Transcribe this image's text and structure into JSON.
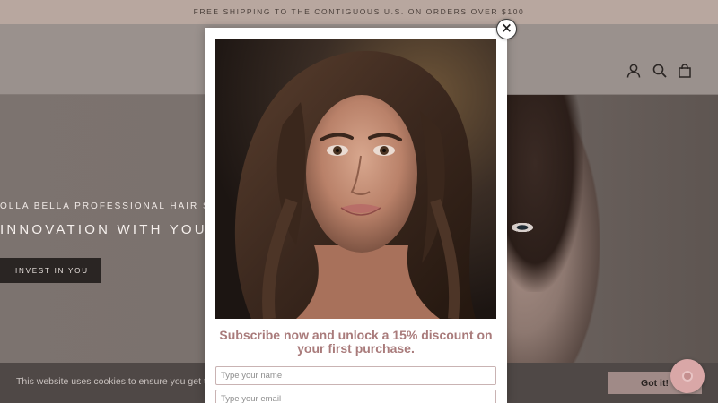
{
  "announcement": {
    "text": "FREE SHIPPING TO THE CONTIGUOUS U.S. ON ORDERS OVER $100"
  },
  "header": {
    "icons": [
      "account-icon",
      "search-icon",
      "cart-icon"
    ]
  },
  "hero": {
    "subtitle": "OLLA BELLA PROFESSIONAL HAIR STR",
    "title": "INNOVATION WITH YOU I",
    "button_label": "INVEST IN YOU"
  },
  "modal": {
    "close_label": "×",
    "promo_text": "Subscribe now and unlock a 15% discount on your first purchase.",
    "name_placeholder": "Type your name",
    "email_placeholder": "Type your email"
  },
  "cookie": {
    "text": "This website uses cookies to ensure you get the",
    "button_label": "Got it!"
  },
  "colors": {
    "announcement_bg": "#b8a79f",
    "accent_pink": "#a97b7b",
    "cookie_button": "#a08a87",
    "chat_bubble": "#d9a7a7"
  }
}
